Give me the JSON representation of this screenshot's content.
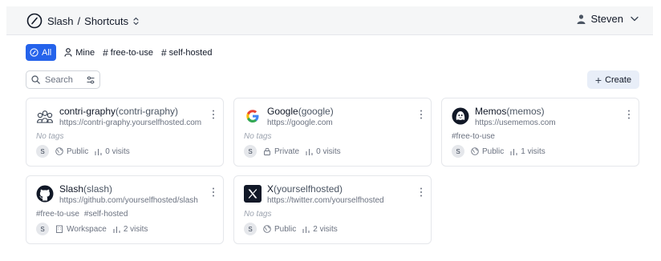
{
  "header": {
    "brand": "Slash",
    "separator": "/",
    "section": "Shortcuts",
    "user_name": "Steven"
  },
  "filters": [
    {
      "label": "All",
      "icon": "check-circle-icon",
      "active": true
    },
    {
      "label": "Mine",
      "icon": "user-icon",
      "active": false
    },
    {
      "label": "free-to-use",
      "icon": "hash-icon",
      "active": false
    },
    {
      "label": "self-hosted",
      "icon": "hash-icon",
      "active": false
    }
  ],
  "search": {
    "placeholder": "Search"
  },
  "create_label": "Create",
  "colors": {
    "accent": "#2563eb",
    "create_bg": "#e8eef8"
  },
  "shortcuts": [
    {
      "title": "contri-graphy",
      "name": "(contri-graphy)",
      "url": "https://contri-graphy.yourselfhosted.com",
      "tags_text": "No tags",
      "tags": [],
      "creator": "S",
      "visibility": "Public",
      "visits": "0 visits",
      "icon": "people-icon"
    },
    {
      "title": "Google",
      "name": "(google)",
      "url": "https://google.com",
      "tags_text": "No tags",
      "tags": [],
      "creator": "S",
      "visibility": "Private",
      "visits": "0 visits",
      "icon": "google-icon"
    },
    {
      "title": "Memos",
      "name": "(memos)",
      "url": "https://usememos.com",
      "tags_text": "",
      "tags": [
        "#free-to-use"
      ],
      "creator": "S",
      "visibility": "Public",
      "visits": "1 visits",
      "icon": "memos-icon"
    },
    {
      "title": "Slash",
      "name": "(slash)",
      "url": "https://github.com/yourselfhosted/slash",
      "tags_text": "",
      "tags": [
        "#free-to-use",
        "#self-hosted"
      ],
      "creator": "S",
      "visibility": "Workspace",
      "visits": "2 visits",
      "icon": "github-icon"
    },
    {
      "title": "X",
      "name": "(yourselfhosted)",
      "url": "https://twitter.com/yourselfhosted",
      "tags_text": "No tags",
      "tags": [],
      "creator": "S",
      "visibility": "Public",
      "visits": "2 visits",
      "icon": "x-icon"
    }
  ]
}
